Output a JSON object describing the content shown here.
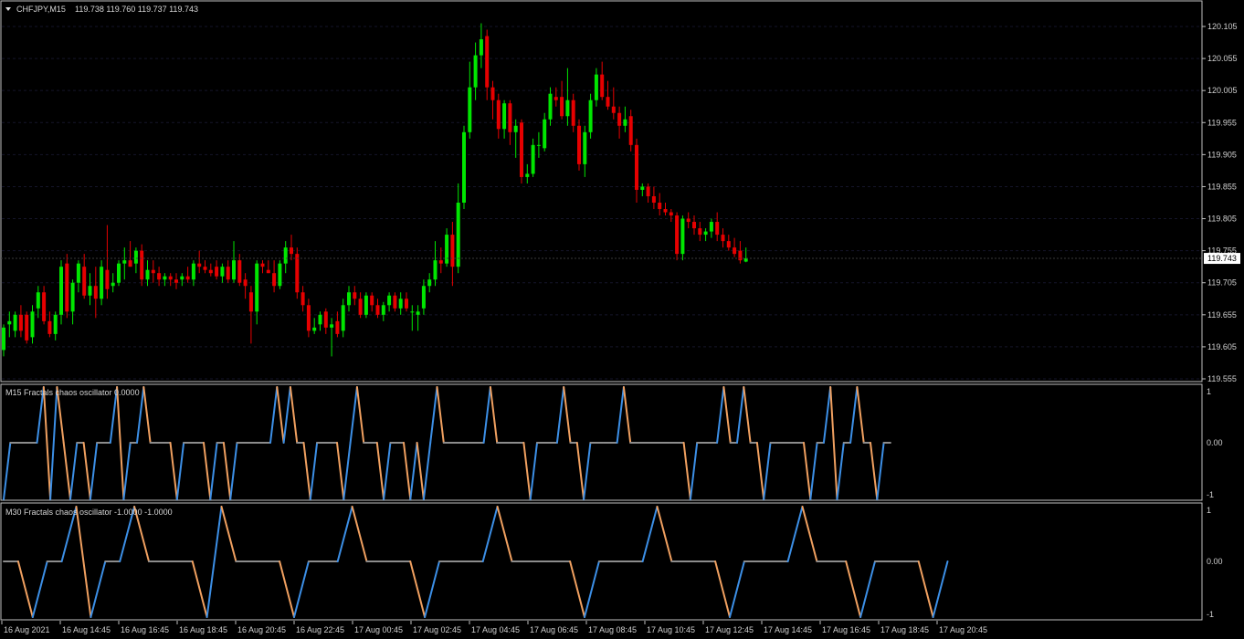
{
  "main_panel": {
    "title": "CHFJPY,M15",
    "ohlc": "119.738 119.760 119.737 119.743",
    "current_price": "119.743",
    "price_ticks": [
      "120.105",
      "120.055",
      "120.005",
      "119.955",
      "119.905",
      "119.855",
      "119.805",
      "119.755",
      "119.705",
      "119.655",
      "119.605",
      "119.555"
    ]
  },
  "osc_m15": {
    "title": "M15 Fractals chaos oscillator 0.0000",
    "ticks": [
      "1",
      "0.00",
      "-1"
    ]
  },
  "osc_m30": {
    "title": "M30 Fractals chaos oscillator -1.0000 -1.0000",
    "ticks": [
      "1",
      "0.00",
      "-1"
    ]
  },
  "time_axis": {
    "labels": [
      "16 Aug 2021",
      "16 Aug 14:45",
      "16 Aug 16:45",
      "16 Aug 18:45",
      "16 Aug 20:45",
      "16 Aug 22:45",
      "17 Aug 00:45",
      "17 Aug 02:45",
      "17 Aug 04:45",
      "17 Aug 06:45",
      "17 Aug 08:45",
      "17 Aug 10:45",
      "17 Aug 12:45",
      "17 Aug 14:45",
      "17 Aug 16:45",
      "17 Aug 18:45",
      "17 Aug 20:45"
    ]
  },
  "colors": {
    "bull": "#00e600",
    "bear": "#e60000",
    "osc_up": "#3c8fe6",
    "osc_down": "#f0a060",
    "osc_flat": "#8c8c8c",
    "border": "#c0c0c0"
  },
  "chart_data": [
    {
      "type": "candlestick",
      "symbol": "CHFJPY",
      "timeframe": "M15",
      "ylim": [
        119.555,
        120.105
      ],
      "candles": [
        {
          "o": 119.6,
          "h": 119.64,
          "l": 119.59,
          "c": 119.635
        },
        {
          "o": 119.64,
          "h": 119.66,
          "l": 119.62,
          "c": 119.645
        },
        {
          "o": 119.63,
          "h": 119.66,
          "l": 119.62,
          "c": 119.655
        },
        {
          "o": 119.655,
          "h": 119.67,
          "l": 119.62,
          "c": 119.63
        },
        {
          "o": 119.655,
          "h": 119.66,
          "l": 119.61,
          "c": 119.615
        },
        {
          "o": 119.62,
          "h": 119.67,
          "l": 119.61,
          "c": 119.66
        },
        {
          "o": 119.665,
          "h": 119.7,
          "l": 119.65,
          "c": 119.69
        },
        {
          "o": 119.69,
          "h": 119.7,
          "l": 119.64,
          "c": 119.645
        },
        {
          "o": 119.645,
          "h": 119.66,
          "l": 119.62,
          "c": 119.625
        },
        {
          "o": 119.625,
          "h": 119.66,
          "l": 119.615,
          "c": 119.655
        },
        {
          "o": 119.655,
          "h": 119.74,
          "l": 119.64,
          "c": 119.73
        },
        {
          "o": 119.735,
          "h": 119.75,
          "l": 119.65,
          "c": 119.66
        },
        {
          "o": 119.66,
          "h": 119.71,
          "l": 119.64,
          "c": 119.705
        },
        {
          "o": 119.705,
          "h": 119.74,
          "l": 119.69,
          "c": 119.735
        },
        {
          "o": 119.73,
          "h": 119.75,
          "l": 119.68,
          "c": 119.685
        },
        {
          "o": 119.685,
          "h": 119.72,
          "l": 119.67,
          "c": 119.7
        },
        {
          "o": 119.7,
          "h": 119.73,
          "l": 119.65,
          "c": 119.68
        },
        {
          "o": 119.68,
          "h": 119.74,
          "l": 119.67,
          "c": 119.73
        },
        {
          "o": 119.725,
          "h": 119.795,
          "l": 119.68,
          "c": 119.695
        },
        {
          "o": 119.7,
          "h": 119.72,
          "l": 119.69,
          "c": 119.705
        },
        {
          "o": 119.705,
          "h": 119.74,
          "l": 119.7,
          "c": 119.735
        },
        {
          "o": 119.735,
          "h": 119.76,
          "l": 119.71,
          "c": 119.74
        },
        {
          "o": 119.74,
          "h": 119.77,
          "l": 119.73,
          "c": 119.73
        },
        {
          "o": 119.735,
          "h": 119.76,
          "l": 119.72,
          "c": 119.755
        },
        {
          "o": 119.755,
          "h": 119.765,
          "l": 119.7,
          "c": 119.71
        },
        {
          "o": 119.71,
          "h": 119.74,
          "l": 119.7,
          "c": 119.725
        },
        {
          "o": 119.725,
          "h": 119.74,
          "l": 119.705,
          "c": 119.72
        },
        {
          "o": 119.72,
          "h": 119.73,
          "l": 119.7,
          "c": 119.71
        },
        {
          "o": 119.71,
          "h": 119.72,
          "l": 119.7,
          "c": 119.715
        },
        {
          "o": 119.715,
          "h": 119.72,
          "l": 119.7,
          "c": 119.71
        },
        {
          "o": 119.71,
          "h": 119.72,
          "l": 119.695,
          "c": 119.705
        },
        {
          "o": 119.71,
          "h": 119.72,
          "l": 119.7,
          "c": 119.715
        },
        {
          "o": 119.715,
          "h": 119.73,
          "l": 119.705,
          "c": 119.71
        },
        {
          "o": 119.71,
          "h": 119.74,
          "l": 119.7,
          "c": 119.735
        },
        {
          "o": 119.735,
          "h": 119.755,
          "l": 119.72,
          "c": 119.73
        },
        {
          "o": 119.73,
          "h": 119.74,
          "l": 119.72,
          "c": 119.725
        },
        {
          "o": 119.725,
          "h": 119.735,
          "l": 119.715,
          "c": 119.72
        },
        {
          "o": 119.73,
          "h": 119.74,
          "l": 119.71,
          "c": 119.715
        },
        {
          "o": 119.715,
          "h": 119.735,
          "l": 119.705,
          "c": 119.73
        },
        {
          "o": 119.73,
          "h": 119.74,
          "l": 119.705,
          "c": 119.71
        },
        {
          "o": 119.71,
          "h": 119.77,
          "l": 119.705,
          "c": 119.74
        },
        {
          "o": 119.74,
          "h": 119.75,
          "l": 119.7,
          "c": 119.705
        },
        {
          "o": 119.71,
          "h": 119.72,
          "l": 119.68,
          "c": 119.7
        },
        {
          "o": 119.69,
          "h": 119.7,
          "l": 119.61,
          "c": 119.66
        },
        {
          "o": 119.66,
          "h": 119.74,
          "l": 119.64,
          "c": 119.735
        },
        {
          "o": 119.735,
          "h": 119.74,
          "l": 119.72,
          "c": 119.73
        },
        {
          "o": 119.725,
          "h": 119.74,
          "l": 119.72,
          "c": 119.72
        },
        {
          "o": 119.72,
          "h": 119.74,
          "l": 119.69,
          "c": 119.7
        },
        {
          "o": 119.7,
          "h": 119.74,
          "l": 119.695,
          "c": 119.735
        },
        {
          "o": 119.735,
          "h": 119.77,
          "l": 119.72,
          "c": 119.76
        },
        {
          "o": 119.76,
          "h": 119.78,
          "l": 119.74,
          "c": 119.75
        },
        {
          "o": 119.75,
          "h": 119.76,
          "l": 119.68,
          "c": 119.69
        },
        {
          "o": 119.69,
          "h": 119.7,
          "l": 119.66,
          "c": 119.67
        },
        {
          "o": 119.67,
          "h": 119.68,
          "l": 119.62,
          "c": 119.63
        },
        {
          "o": 119.63,
          "h": 119.65,
          "l": 119.625,
          "c": 119.635
        },
        {
          "o": 119.64,
          "h": 119.66,
          "l": 119.63,
          "c": 119.655
        },
        {
          "o": 119.66,
          "h": 119.665,
          "l": 119.625,
          "c": 119.635
        },
        {
          "o": 119.635,
          "h": 119.65,
          "l": 119.59,
          "c": 119.64
        },
        {
          "o": 119.645,
          "h": 119.66,
          "l": 119.62,
          "c": 119.625
        },
        {
          "o": 119.63,
          "h": 119.68,
          "l": 119.62,
          "c": 119.67
        },
        {
          "o": 119.67,
          "h": 119.7,
          "l": 119.66,
          "c": 119.69
        },
        {
          "o": 119.69,
          "h": 119.7,
          "l": 119.67,
          "c": 119.68
        },
        {
          "o": 119.68,
          "h": 119.69,
          "l": 119.65,
          "c": 119.655
        },
        {
          "o": 119.655,
          "h": 119.69,
          "l": 119.65,
          "c": 119.685
        },
        {
          "o": 119.685,
          "h": 119.69,
          "l": 119.66,
          "c": 119.67
        },
        {
          "o": 119.67,
          "h": 119.68,
          "l": 119.65,
          "c": 119.655
        },
        {
          "o": 119.655,
          "h": 119.675,
          "l": 119.645,
          "c": 119.67
        },
        {
          "o": 119.67,
          "h": 119.69,
          "l": 119.66,
          "c": 119.685
        },
        {
          "o": 119.685,
          "h": 119.69,
          "l": 119.66,
          "c": 119.665
        },
        {
          "o": 119.665,
          "h": 119.69,
          "l": 119.655,
          "c": 119.68
        },
        {
          "o": 119.68,
          "h": 119.69,
          "l": 119.66,
          "c": 119.665
        },
        {
          "o": 119.66,
          "h": 119.67,
          "l": 119.63,
          "c": 119.66
        },
        {
          "o": 119.655,
          "h": 119.67,
          "l": 119.63,
          "c": 119.66
        },
        {
          "o": 119.665,
          "h": 119.71,
          "l": 119.655,
          "c": 119.7
        },
        {
          "o": 119.7,
          "h": 119.72,
          "l": 119.69,
          "c": 119.71
        },
        {
          "o": 119.71,
          "h": 119.77,
          "l": 119.7,
          "c": 119.74
        },
        {
          "o": 119.74,
          "h": 119.76,
          "l": 119.72,
          "c": 119.735
        },
        {
          "o": 119.735,
          "h": 119.79,
          "l": 119.73,
          "c": 119.78
        },
        {
          "o": 119.78,
          "h": 119.8,
          "l": 119.7,
          "c": 119.73
        },
        {
          "o": 119.73,
          "h": 119.86,
          "l": 119.72,
          "c": 119.83
        },
        {
          "o": 119.83,
          "h": 119.95,
          "l": 119.82,
          "c": 119.94
        },
        {
          "o": 119.94,
          "h": 120.05,
          "l": 119.93,
          "c": 120.01
        },
        {
          "o": 120.01,
          "h": 120.08,
          "l": 119.99,
          "c": 120.06
        },
        {
          "o": 120.06,
          "h": 120.11,
          "l": 120.04,
          "c": 120.085
        },
        {
          "o": 120.09,
          "h": 120.1,
          "l": 119.99,
          "c": 120.01
        },
        {
          "o": 120.01,
          "h": 120.02,
          "l": 119.96,
          "c": 119.99
        },
        {
          "o": 119.99,
          "h": 120.0,
          "l": 119.93,
          "c": 119.945
        },
        {
          "o": 119.945,
          "h": 119.99,
          "l": 119.93,
          "c": 119.985
        },
        {
          "o": 119.985,
          "h": 119.99,
          "l": 119.92,
          "c": 119.94
        },
        {
          "o": 119.94,
          "h": 119.96,
          "l": 119.9,
          "c": 119.95
        },
        {
          "o": 119.955,
          "h": 119.96,
          "l": 119.86,
          "c": 119.87
        },
        {
          "o": 119.87,
          "h": 119.89,
          "l": 119.86,
          "c": 119.875
        },
        {
          "o": 119.875,
          "h": 119.93,
          "l": 119.87,
          "c": 119.92
        },
        {
          "o": 119.92,
          "h": 119.94,
          "l": 119.9,
          "c": 119.92
        },
        {
          "o": 119.915,
          "h": 119.97,
          "l": 119.91,
          "c": 119.96
        },
        {
          "o": 119.96,
          "h": 120.01,
          "l": 119.95,
          "c": 120.0
        },
        {
          "o": 119.995,
          "h": 120.01,
          "l": 119.98,
          "c": 119.99
        },
        {
          "o": 119.995,
          "h": 120.02,
          "l": 119.96,
          "c": 119.965
        },
        {
          "o": 119.965,
          "h": 120.04,
          "l": 119.95,
          "c": 119.99
        },
        {
          "o": 119.99,
          "h": 120.0,
          "l": 119.94,
          "c": 119.95
        },
        {
          "o": 119.95,
          "h": 119.96,
          "l": 119.88,
          "c": 119.89
        },
        {
          "o": 119.89,
          "h": 119.95,
          "l": 119.87,
          "c": 119.94
        },
        {
          "o": 119.94,
          "h": 120.0,
          "l": 119.93,
          "c": 119.99
        },
        {
          "o": 119.99,
          "h": 120.04,
          "l": 119.98,
          "c": 120.03
        },
        {
          "o": 120.03,
          "h": 120.05,
          "l": 119.99,
          "c": 119.995
        },
        {
          "o": 119.995,
          "h": 120.02,
          "l": 119.975,
          "c": 119.98
        },
        {
          "o": 119.98,
          "h": 120.01,
          "l": 119.96,
          "c": 119.97
        },
        {
          "o": 119.97,
          "h": 119.98,
          "l": 119.93,
          "c": 119.95
        },
        {
          "o": 119.95,
          "h": 119.98,
          "l": 119.94,
          "c": 119.96
        },
        {
          "o": 119.965,
          "h": 119.975,
          "l": 119.91,
          "c": 119.92
        },
        {
          "o": 119.92,
          "h": 119.93,
          "l": 119.83,
          "c": 119.85
        },
        {
          "o": 119.85,
          "h": 119.86,
          "l": 119.84,
          "c": 119.855
        },
        {
          "o": 119.855,
          "h": 119.86,
          "l": 119.83,
          "c": 119.84
        },
        {
          "o": 119.84,
          "h": 119.855,
          "l": 119.82,
          "c": 119.83
        },
        {
          "o": 119.83,
          "h": 119.845,
          "l": 119.81,
          "c": 119.82
        },
        {
          "o": 119.82,
          "h": 119.83,
          "l": 119.81,
          "c": 119.815
        },
        {
          "o": 119.815,
          "h": 119.82,
          "l": 119.8,
          "c": 119.81
        },
        {
          "o": 119.81,
          "h": 119.815,
          "l": 119.74,
          "c": 119.75
        },
        {
          "o": 119.75,
          "h": 119.81,
          "l": 119.74,
          "c": 119.805
        },
        {
          "o": 119.805,
          "h": 119.815,
          "l": 119.79,
          "c": 119.8
        },
        {
          "o": 119.8,
          "h": 119.81,
          "l": 119.78,
          "c": 119.79
        },
        {
          "o": 119.79,
          "h": 119.8,
          "l": 119.77,
          "c": 119.78
        },
        {
          "o": 119.78,
          "h": 119.79,
          "l": 119.77,
          "c": 119.785
        },
        {
          "o": 119.785,
          "h": 119.805,
          "l": 119.775,
          "c": 119.8
        },
        {
          "o": 119.8,
          "h": 119.815,
          "l": 119.77,
          "c": 119.78
        },
        {
          "o": 119.78,
          "h": 119.79,
          "l": 119.76,
          "c": 119.77
        },
        {
          "o": 119.77,
          "h": 119.78,
          "l": 119.755,
          "c": 119.76
        },
        {
          "o": 119.76,
          "h": 119.775,
          "l": 119.745,
          "c": 119.75
        },
        {
          "o": 119.755,
          "h": 119.77,
          "l": 119.735,
          "c": 119.74
        },
        {
          "o": 119.738,
          "h": 119.76,
          "l": 119.737,
          "c": 119.743
        }
      ]
    },
    {
      "type": "line",
      "name": "M15 Fractals chaos oscillator",
      "ylim": [
        -1,
        1
      ],
      "values": [
        -1,
        0,
        0,
        0,
        0,
        0,
        1,
        -1,
        1,
        0,
        -1,
        0,
        0,
        -1,
        0,
        0,
        0,
        1,
        -1,
        0,
        0,
        1,
        0,
        0,
        0,
        0,
        -1,
        0,
        0,
        0,
        0,
        -1,
        0,
        0,
        -1,
        0,
        0,
        0,
        0,
        0,
        0,
        1,
        0,
        1,
        0,
        0,
        -1,
        0,
        0,
        0,
        0,
        -1,
        0,
        1,
        0,
        0,
        0,
        -1,
        0,
        0,
        0,
        -1,
        0,
        -1,
        0,
        1,
        0,
        0,
        0,
        0,
        0,
        0,
        0,
        1,
        0,
        0,
        0,
        0,
        0,
        -1,
        0,
        0,
        0,
        0,
        1,
        0,
        0,
        -1,
        0,
        0,
        0,
        0,
        0,
        1,
        0,
        0,
        0,
        0,
        0,
        0,
        0,
        0,
        0,
        -1,
        0,
        0,
        0,
        0,
        1,
        0,
        0,
        1,
        0,
        0,
        -1,
        0,
        0,
        0,
        0,
        0,
        0,
        -1,
        0,
        0,
        1,
        -1,
        0,
        0,
        1,
        0,
        0,
        -1,
        0,
        0
      ]
    },
    {
      "type": "line",
      "name": "M30 Fractals chaos oscillator",
      "ylim": [
        -1,
        1
      ],
      "values": [
        0,
        0,
        -1,
        0,
        0,
        1,
        -1,
        0,
        0,
        1,
        0,
        0,
        0,
        0,
        -1,
        1,
        0,
        0,
        0,
        0,
        -1,
        0,
        0,
        0,
        1,
        0,
        0,
        0,
        0,
        -1,
        0,
        0,
        0,
        0,
        1,
        0,
        0,
        0,
        0,
        0,
        -1,
        0,
        0,
        0,
        0,
        1,
        0,
        0,
        0,
        0,
        -1,
        0,
        0,
        0,
        0,
        1,
        0,
        0,
        0,
        -1,
        0,
        0,
        0,
        0,
        -1,
        0
      ]
    }
  ]
}
